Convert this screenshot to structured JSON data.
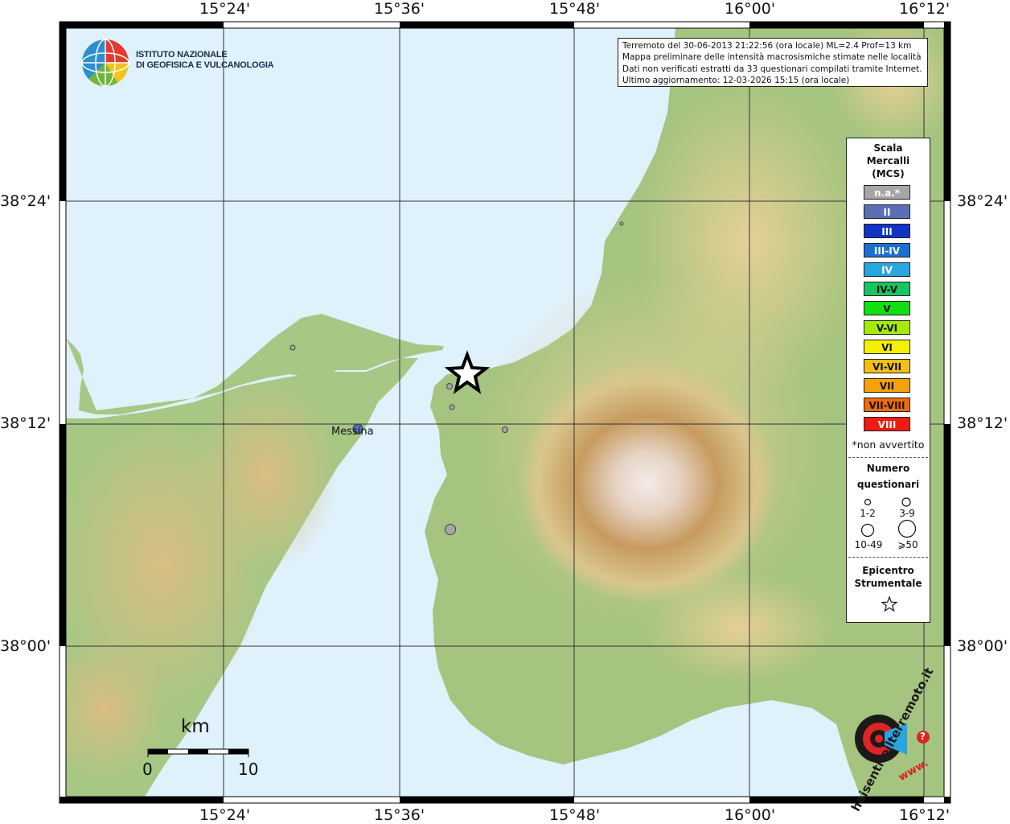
{
  "map": {
    "top_lon_labels": [
      "15°24'",
      "15°36'",
      "15°48'",
      "16°00'",
      "16°12'"
    ],
    "bottom_lon_labels": [
      "15°24'",
      "15°36'",
      "15°48'",
      "16°00'",
      "16°12'"
    ],
    "left_lat_labels": [
      "38°24'",
      "38°12'",
      "38°00'"
    ],
    "right_lat_labels": [
      "38°24'",
      "38°12'",
      "38°00'"
    ],
    "city_label": "Messina",
    "colors": {
      "sea": "#dff1fb",
      "land_low": "#8fbd6e",
      "land_mid": "#d8c790",
      "land_high": "#b6894a",
      "peak": "#ede2dc"
    }
  },
  "logo": {
    "line1": "ISTITUTO NAZIONALE",
    "line2": "DI GEOFISICA E VULCANOLOGIA"
  },
  "info": {
    "line1": "Terremoto del 30-06-2013 21:22:56 (ora locale) ML=2.4 Prof=13 km",
    "line2": "Mappa preliminare delle intensità macrosismiche stimate nelle località",
    "line3": "Dati non verificati estratti da 33 questionari compilati tramite Internet.",
    "line4": "Ultimo aggiornamento: 12-03-2026 15:15 (ora locale)"
  },
  "legend": {
    "title1": "Scala",
    "title2": "Mercalli",
    "title3": "(MCS)",
    "scale": [
      {
        "label": "n.a.*",
        "color": "#a6a6a6",
        "text": "#ffffff"
      },
      {
        "label": "II",
        "color": "#5b6fb6",
        "text": "#ffffff"
      },
      {
        "label": "III",
        "color": "#1133c4",
        "text": "#ffffff"
      },
      {
        "label": "III-IV",
        "color": "#1a6fd0",
        "text": "#ffffff"
      },
      {
        "label": "IV",
        "color": "#27a6e0",
        "text": "#ffffff"
      },
      {
        "label": "IV-V",
        "color": "#19c463",
        "text": "#111111"
      },
      {
        "label": "V",
        "color": "#10e010",
        "text": "#111111"
      },
      {
        "label": "V-VI",
        "color": "#a4eb0c",
        "text": "#111111"
      },
      {
        "label": "VI",
        "color": "#f5f000",
        "text": "#111111"
      },
      {
        "label": "VI-VII",
        "color": "#f3bf14",
        "text": "#111111"
      },
      {
        "label": "VII",
        "color": "#f4a20c",
        "text": "#111111"
      },
      {
        "label": "VII-VIII",
        "color": "#f06a08",
        "text": "#111111"
      },
      {
        "label": "VIII",
        "color": "#ef1b12",
        "text": "#ffffff"
      }
    ],
    "not_felt": "*non avvertito",
    "count_title1": "Numero",
    "count_title2": "questionari",
    "counts": [
      "1-2",
      "3-9",
      "10-49",
      "⩾50"
    ],
    "epicenter_title1": "Epicentro",
    "epicenter_title2": "Strumentale"
  },
  "scalebar": {
    "unit": "km",
    "min": "0",
    "max": "10"
  },
  "watermark": {
    "text": "haisentitoilterremoto.it",
    "url": "www.",
    "mark": "?"
  }
}
